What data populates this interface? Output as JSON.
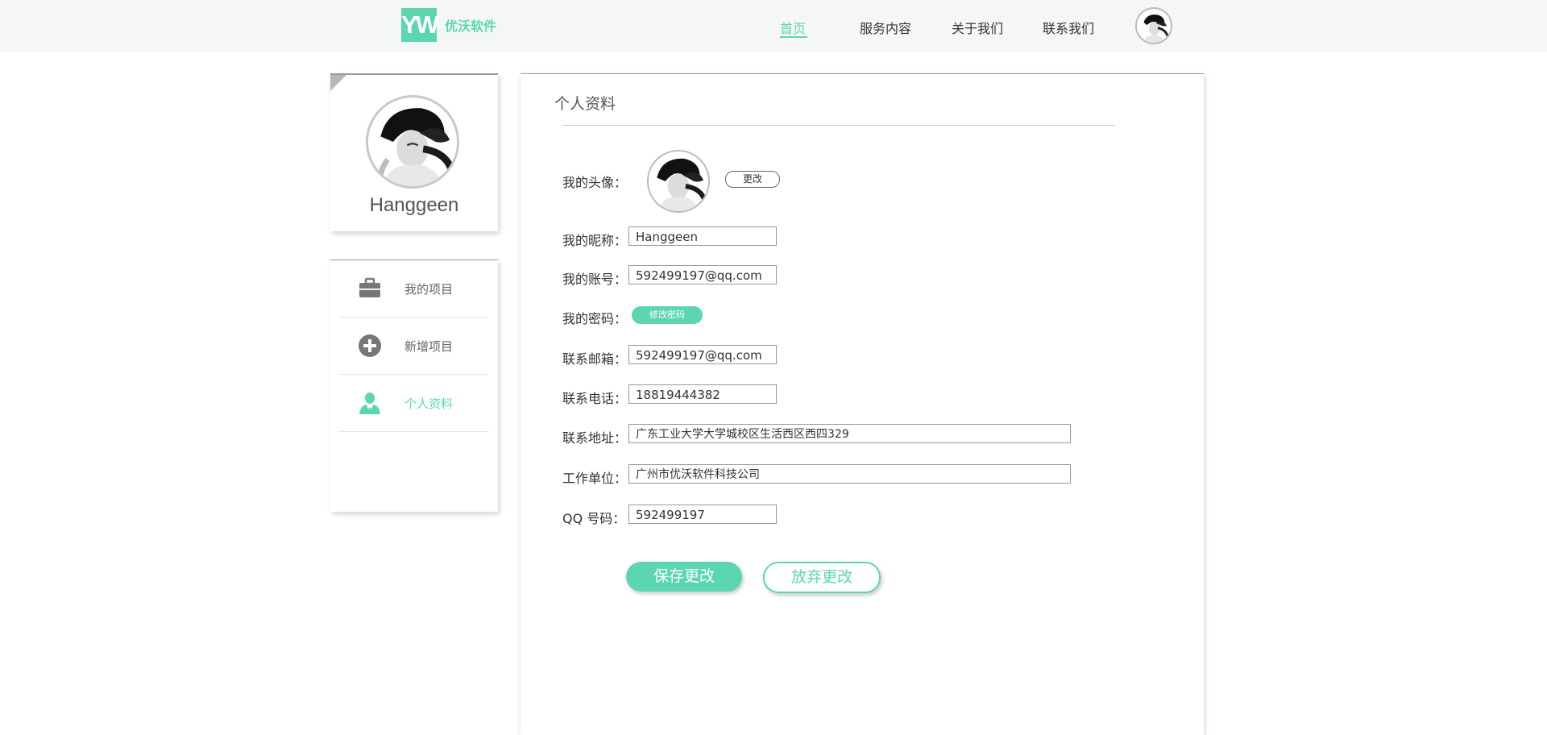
{
  "header": {
    "logo_mark": "YW",
    "logo_text": "优沃软件",
    "nav": [
      {
        "label": "首页",
        "active": true
      },
      {
        "label": "服务内容",
        "active": false
      },
      {
        "label": "关于我们",
        "active": false
      },
      {
        "label": "联系我们",
        "active": false
      }
    ],
    "avatar_icon": "user-avatar-photo"
  },
  "sidebar": {
    "profile": {
      "name": "Hanggeen",
      "avatar_icon": "user-avatar-photo"
    },
    "menu": [
      {
        "label": "我的项目",
        "icon": "briefcase-icon",
        "active": false
      },
      {
        "label": "新增项目",
        "icon": "plus-circle-icon",
        "active": false
      },
      {
        "label": "个人资料",
        "icon": "person-icon",
        "active": true
      }
    ]
  },
  "main": {
    "title": "个人资料",
    "avatar": {
      "label": "我的头像：",
      "change_button": "更改"
    },
    "fields": {
      "nickname": {
        "label": "我的昵称：",
        "value": "Hanggeen"
      },
      "account": {
        "label": "我的账号：",
        "value": "592499197@qq.com"
      },
      "password": {
        "label": "我的密码：",
        "button": "修改密码"
      },
      "email": {
        "label": "联系邮箱：",
        "value": "592499197@qq.com"
      },
      "phone": {
        "label": "联系电话：",
        "value": "18819444382"
      },
      "address": {
        "label": "联系地址：",
        "value": "广东工业大学大学城校区生活西区西四329"
      },
      "company": {
        "label": "工作单位：",
        "value": "广州市优沃软件科技公司"
      },
      "qq": {
        "label": "QQ 号码：",
        "value": "592499197"
      }
    },
    "save_button": "保存更改",
    "discard_button": "放弃更改"
  },
  "colors": {
    "accent": "#5cd6b0",
    "topbar_bg": "#f4f7f6",
    "icon_gray": "#777777"
  }
}
